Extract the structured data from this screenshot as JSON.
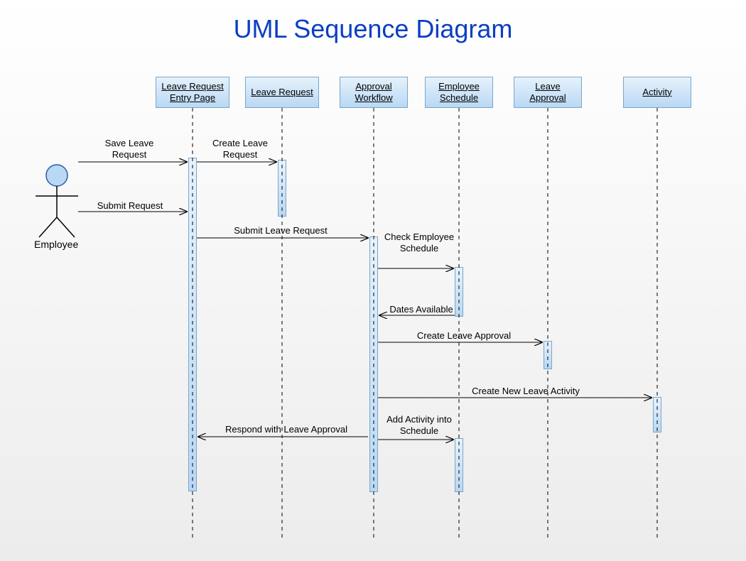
{
  "title": "UML Sequence Diagram",
  "actor": {
    "name": "Employee"
  },
  "lifelines": {
    "entryPage": {
      "label": "Leave Request Entry Page"
    },
    "leaveReq": {
      "label": "Leave Request"
    },
    "approvalWF": {
      "label": "Approval Workflow"
    },
    "empSched": {
      "label": "Employee Schedule"
    },
    "leaveAppr": {
      "label": "Leave Approval"
    },
    "activity": {
      "label": "Activity"
    }
  },
  "messages": {
    "saveLeave": "Save Leave Request",
    "createLeave": "Create Leave Request",
    "submitReq": "Submit  Request",
    "submitLeaveReq": "Submit  Leave Request",
    "checkEmpSched": "Check Employee Schedule",
    "datesAvail": "Dates Available",
    "createLeaveAppr": "Create Leave Approval",
    "createNewAct": "Create New Leave Activity",
    "addActSched": "Add Activity into Schedule",
    "respondAppr": "Respond with Leave Approval"
  }
}
